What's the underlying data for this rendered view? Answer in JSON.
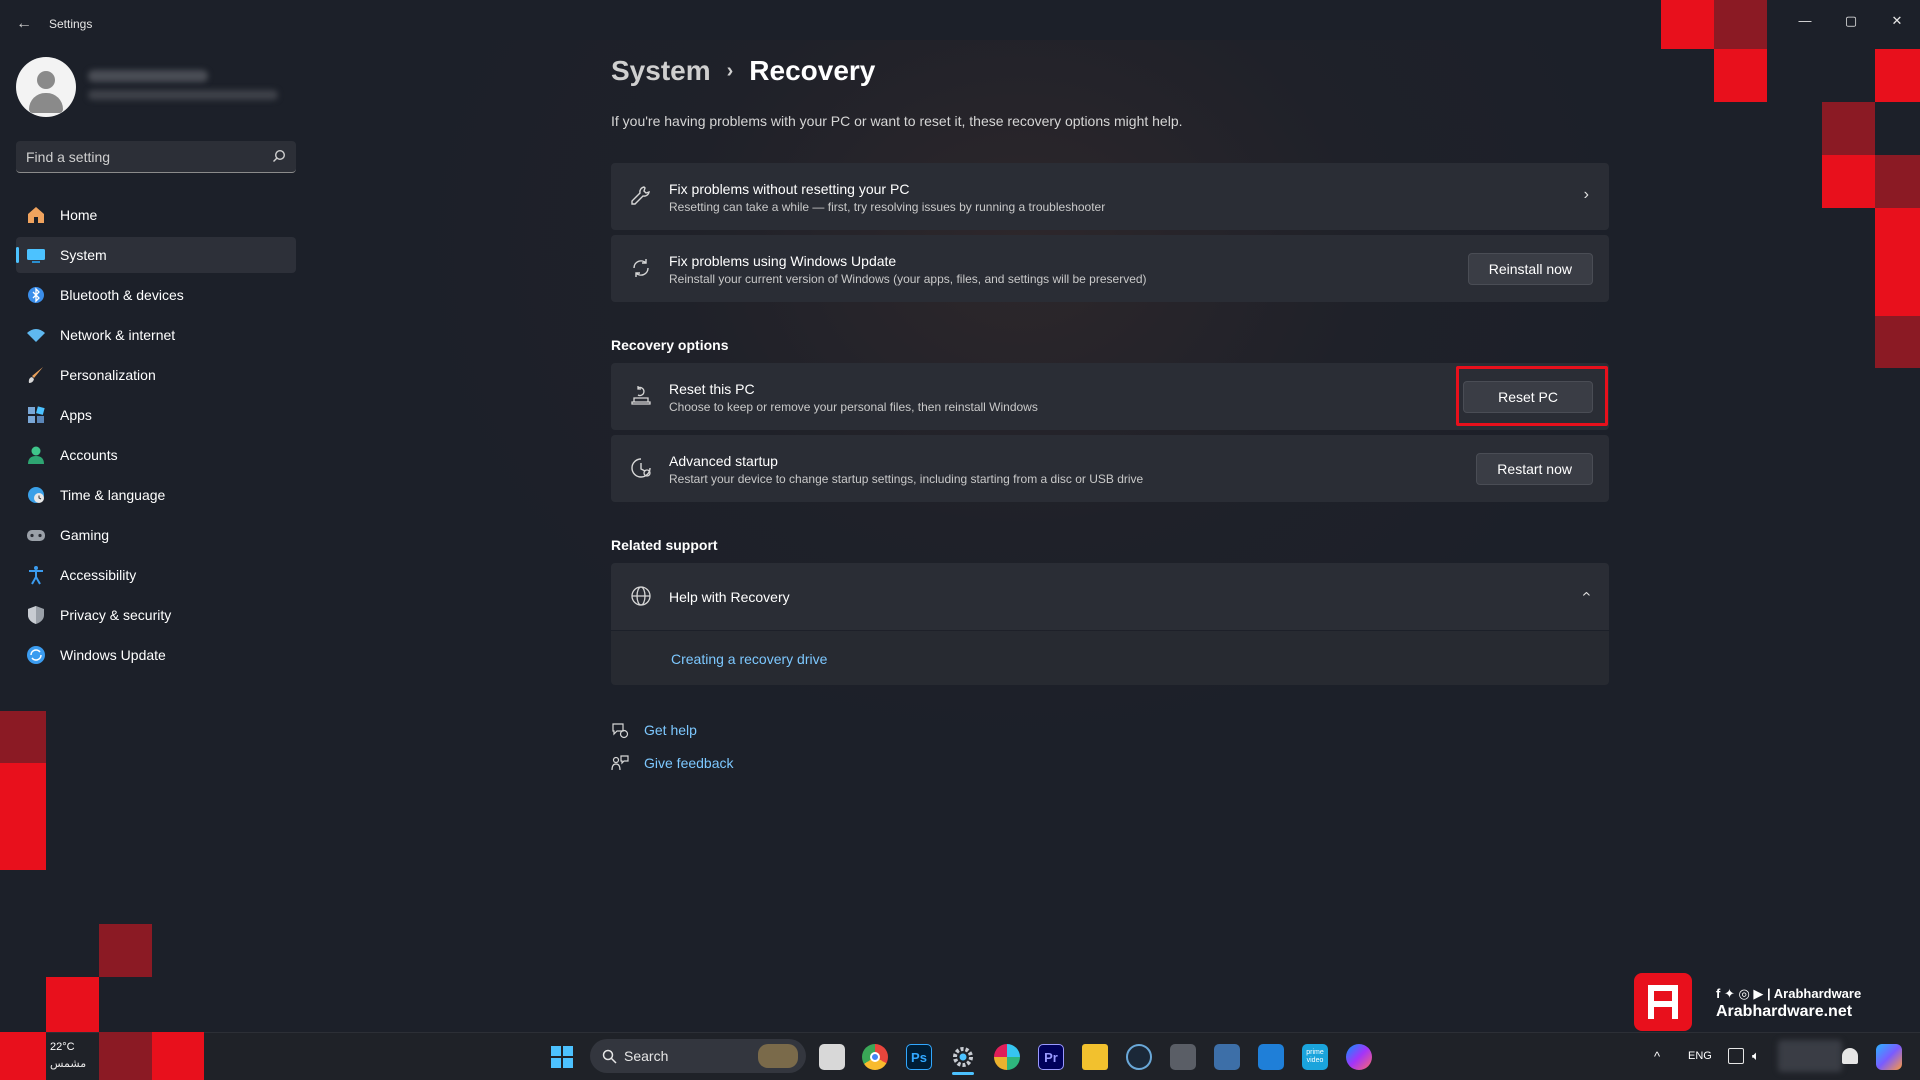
{
  "window": {
    "app_title": "Settings",
    "controls": {
      "minimize": "—",
      "maximize": "▢",
      "close": "✕"
    }
  },
  "sidebar": {
    "search_placeholder": "Find a setting",
    "items": [
      {
        "label": "Home",
        "icon": "home-icon",
        "color": "#f0a35e"
      },
      {
        "label": "System",
        "icon": "system-icon",
        "color": "#4cc2ff",
        "active": true
      },
      {
        "label": "Bluetooth & devices",
        "icon": "bluetooth-icon",
        "color": "#3b8eea"
      },
      {
        "label": "Network & internet",
        "icon": "wifi-icon",
        "color": "#5fb8f0"
      },
      {
        "label": "Personalization",
        "icon": "brush-icon",
        "color": "#e9a15b"
      },
      {
        "label": "Apps",
        "icon": "apps-icon",
        "color": "#7aa7d6"
      },
      {
        "label": "Accounts",
        "icon": "accounts-icon",
        "color": "#3fc58a"
      },
      {
        "label": "Time & language",
        "icon": "globe-clock-icon",
        "color": "#3aa0e8"
      },
      {
        "label": "Gaming",
        "icon": "gamepad-icon",
        "color": "#9aa0a8"
      },
      {
        "label": "Accessibility",
        "icon": "accessibility-icon",
        "color": "#3b9cf0"
      },
      {
        "label": "Privacy & security",
        "icon": "shield-icon",
        "color": "#9aa0a8"
      },
      {
        "label": "Windows Update",
        "icon": "update-icon",
        "color": "#3b9cf0"
      }
    ]
  },
  "main": {
    "breadcrumb_parent": "System",
    "breadcrumb_sep": "›",
    "page_title": "Recovery",
    "intro": "If you're having problems with your PC or want to reset it, these recovery options might help.",
    "fix_without_reset": {
      "title": "Fix problems without resetting your PC",
      "desc": "Resetting can take a while — first, try resolving issues by running a troubleshooter"
    },
    "fix_windows_update": {
      "title": "Fix problems using Windows Update",
      "desc": "Reinstall your current version of Windows (your apps, files, and settings will be preserved)",
      "button": "Reinstall now"
    },
    "recovery_options_heading": "Recovery options",
    "reset_pc": {
      "title": "Reset this PC",
      "desc": "Choose to keep or remove your personal files, then reinstall Windows",
      "button": "Reset PC"
    },
    "advanced_startup": {
      "title": "Advanced startup",
      "desc": "Restart your device to change startup settings, including starting from a disc or USB drive",
      "button": "Restart now"
    },
    "related_support_heading": "Related support",
    "help_with_recovery": {
      "title": "Help with Recovery",
      "link": "Creating a recovery drive"
    },
    "get_help": "Get help",
    "give_feedback": "Give feedback"
  },
  "taskbar": {
    "weather_temp": "22°C",
    "weather_desc": "مشمس",
    "search_label": "Search",
    "language": "ENG",
    "apps": [
      "start-icon",
      "task-view-icon",
      "chrome-icon",
      "photoshop-icon",
      "settings-icon",
      "slack-icon",
      "premiere-icon",
      "file-explorer-icon",
      "steam-icon",
      "calculator-icon",
      "photos-icon",
      "store-icon",
      "prime-video-icon",
      "messenger-icon"
    ],
    "app_labels": {
      "photoshop": "Ps",
      "premiere": "Pr",
      "prime": "prime video"
    }
  },
  "watermark": {
    "social": "f ✦ ◎ ▶ | Arabhardware",
    "site": "Arabhardware.net"
  },
  "colors": {
    "accent": "#4cc2ff",
    "highlight_box": "#e8101c",
    "link": "#7dc8ff",
    "deco_red": "#e8101c",
    "deco_dark_red": "#8b1a24"
  }
}
